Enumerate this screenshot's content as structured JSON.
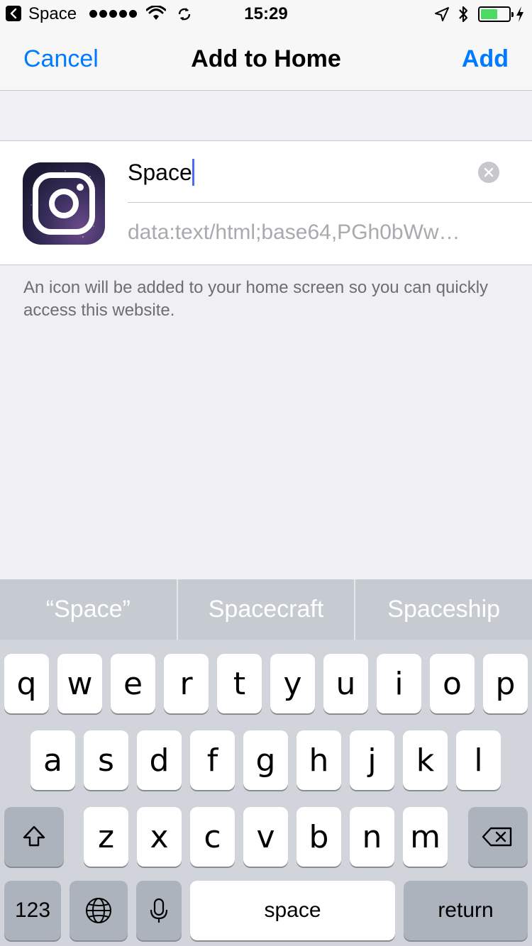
{
  "status_bar": {
    "app_name": "Space",
    "time": "15:29",
    "battery_level": 0.6
  },
  "nav": {
    "cancel_label": "Cancel",
    "title": "Add to Home",
    "add_label": "Add"
  },
  "form": {
    "title_value": "Space",
    "url_value": "data:text/html;base64,PGh0bWw…"
  },
  "hint_text": "An icon will be added to your home screen so you can quickly access this website.",
  "suggestions": [
    "“Space”",
    "Spacecraft",
    "Spaceship"
  ],
  "keyboard": {
    "row1": [
      "q",
      "w",
      "e",
      "r",
      "t",
      "y",
      "u",
      "i",
      "o",
      "p"
    ],
    "row2": [
      "a",
      "s",
      "d",
      "f",
      "g",
      "h",
      "j",
      "k",
      "l"
    ],
    "row3": [
      "z",
      "x",
      "c",
      "v",
      "b",
      "n",
      "m"
    ],
    "numbers_label": "123",
    "space_label": "space",
    "return_label": "return"
  },
  "icons": {
    "back": "back-arrow-icon",
    "wifi": "wifi-icon",
    "sync": "sync-icon",
    "location": "location-arrow-icon",
    "bluetooth": "bluetooth-icon",
    "battery": "battery-icon",
    "charging": "charging-bolt-icon",
    "app": "instagram-camera-icon",
    "clear": "clear-text-icon",
    "shift": "shift-icon",
    "delete": "delete-icon",
    "globe": "globe-icon",
    "mic": "microphone-icon"
  },
  "colors": {
    "accent": "#007aff",
    "battery_fill": "#4cd964",
    "caret": "#4a6cf7"
  }
}
